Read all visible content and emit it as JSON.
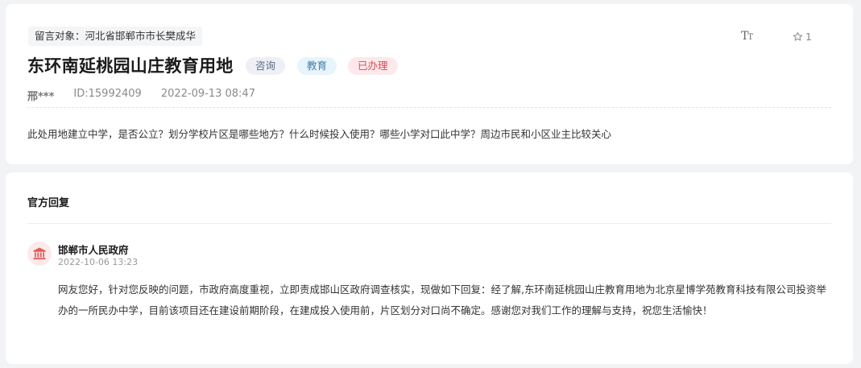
{
  "question": {
    "target_label": "留言对象：河北省邯郸市市长樊成华",
    "title": "东环南延桃园山庄教育用地",
    "tags": {
      "type": "咨询",
      "category": "教育",
      "status": "已办理"
    },
    "font_size_label_big": "T",
    "font_size_label_small": "T",
    "like_count": "1",
    "author": "邢***",
    "id_text": "ID:15992409",
    "time": "2022-09-13 08:47",
    "content": "此处用地建立中学，是否公立？划分学校片区是哪些地方？什么时候投入使用？哪些小学对口此中学？周边市民和小区业主比较关心"
  },
  "reply": {
    "section_title": "官方回复",
    "org_name": "邯郸市人民政府",
    "org_icon": "government-building-icon",
    "time": "2022-10-06 13:23",
    "text": "网友您好，针对您反映的问题，市政府高度重视，立即责成邯山区政府调查核实，现做如下回复：经了解,东环南延桃园山庄教育用地为北京星博学苑教育科技有限公司投资举办的一所民办中学，目前该项目还在建设前期阶段，在建成投入使用前，片区划分对口尚不确定。感谢您对我们工作的理解与支持，祝您生活愉快！"
  },
  "colors": {
    "status_done": "#d84a5a",
    "category_edu": "#3e7fa8",
    "type_consult": "#5c6b86",
    "org_icon": "#e05a5a"
  }
}
